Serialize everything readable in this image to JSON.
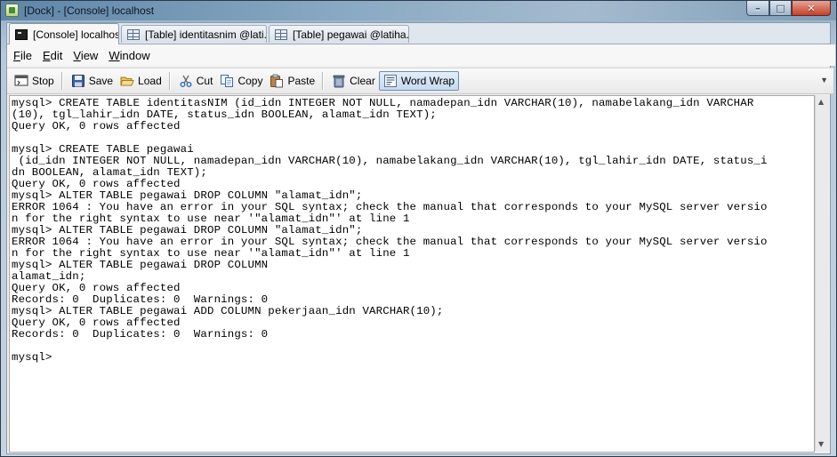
{
  "window": {
    "title": "[Dock] - [Console] localhost"
  },
  "tabs": [
    {
      "label": "[Console] localhost",
      "active": true,
      "icon": "console-icon"
    },
    {
      "label": "[Table] identitasnim @lati...",
      "active": false,
      "icon": "table-icon"
    },
    {
      "label": "[Table] pegawai @latiha...",
      "active": false,
      "icon": "table-icon"
    }
  ],
  "menu": {
    "file": "File",
    "edit": "Edit",
    "view": "View",
    "window": "Window"
  },
  "toolbar": {
    "stop": "Stop",
    "save": "Save",
    "load": "Load",
    "cut": "Cut",
    "copy": "Copy",
    "paste": "Paste",
    "clear": "Clear",
    "word_wrap": "Word Wrap",
    "word_wrap_enabled": true
  },
  "console": {
    "output": "mysql> CREATE TABLE identitasNIM (id_idn INTEGER NOT NULL, namadepan_idn VARCHAR(10), namabelakang_idn VARCHAR\n(10), tgl_lahir_idn DATE, status_idn BOOLEAN, alamat_idn TEXT);\nQuery OK, 0 rows affected\n\nmysql> CREATE TABLE pegawai\n (id_idn INTEGER NOT NULL, namadepan_idn VARCHAR(10), namabelakang_idn VARCHAR(10), tgl_lahir_idn DATE, status_i\ndn BOOLEAN, alamat_idn TEXT);\nQuery OK, 0 rows affected\nmysql> ALTER TABLE pegawai DROP COLUMN \"alamat_idn\";\nERROR 1064 : You have an error in your SQL syntax; check the manual that corresponds to your MySQL server versio\nn for the right syntax to use near '\"alamat_idn\"' at line 1\nmysql> ALTER TABLE pegawai DROP COLUMN \"alamat_idn\";\nERROR 1064 : You have an error in your SQL syntax; check the manual that corresponds to your MySQL server versio\nn for the right syntax to use near '\"alamat_idn\"' at line 1\nmysql> ALTER TABLE pegawai DROP COLUMN\nalamat_idn;\nQuery OK, 0 rows affected\nRecords: 0  Duplicates: 0  Warnings: 0\nmysql> ALTER TABLE pegawai ADD COLUMN pekerjaan_idn VARCHAR(10);\nQuery OK, 0 rows affected\nRecords: 0  Duplicates: 0  Warnings: 0\n\nmysql>"
  }
}
